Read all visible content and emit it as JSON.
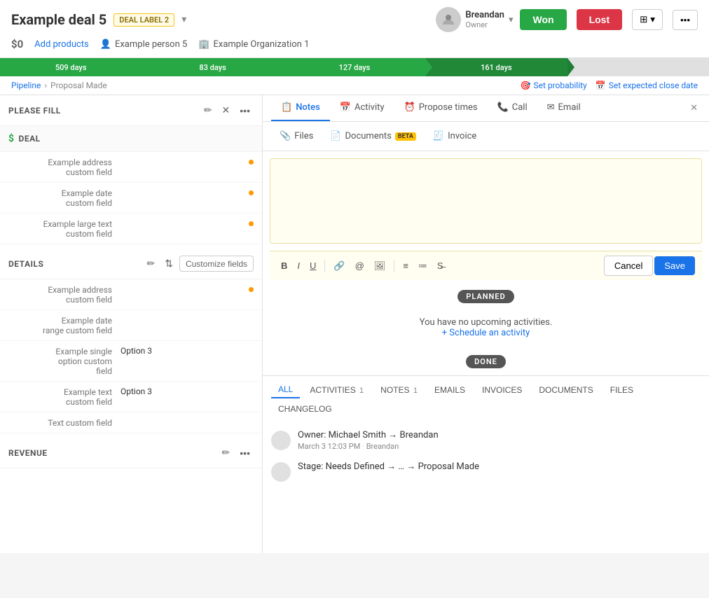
{
  "header": {
    "deal_title": "Example deal 5",
    "deal_label": "DEAL LABEL 2",
    "owner_name": "Breandan",
    "owner_role": "Owner",
    "btn_won": "Won",
    "btn_lost": "Lost",
    "amount": "$0",
    "add_products": "Add products",
    "person": "Example person 5",
    "organization": "Example Organization 1"
  },
  "progress": {
    "segments": [
      {
        "label": "509 days",
        "width": 20,
        "type": "green"
      },
      {
        "label": "83 days",
        "width": 20,
        "type": "green"
      },
      {
        "label": "127 days",
        "width": 20,
        "type": "green"
      },
      {
        "label": "161 days",
        "width": 20,
        "type": "green-dark"
      },
      {
        "label": "",
        "width": 20,
        "type": "gray"
      }
    ]
  },
  "breadcrumb": {
    "pipeline": "Pipeline",
    "stage": "Proposal Made",
    "set_probability": "Set probability",
    "set_close_date": "Set expected close date"
  },
  "please_fill": {
    "title": "PLEASE FILL",
    "section_icon": "✏️"
  },
  "deal_section": {
    "title": "DEAL",
    "fields": [
      {
        "label": "Example address custom field",
        "value": "",
        "required": true
      },
      {
        "label": "Example date custom field",
        "value": "",
        "required": true
      },
      {
        "label": "Example large text custom field",
        "value": "",
        "required": true
      }
    ]
  },
  "details_section": {
    "title": "DETAILS",
    "customize_btn": "Customize fields",
    "fields": [
      {
        "label": "Example address custom field",
        "value": "",
        "required": true
      },
      {
        "label": "Example date range custom field",
        "value": "",
        "required": false
      },
      {
        "label": "Example single option custom field",
        "value": "Option 3",
        "required": false
      },
      {
        "label": "Example text custom field",
        "value": "Option 3",
        "required": false
      },
      {
        "label": "Text custom field",
        "value": "",
        "required": false
      }
    ]
  },
  "revenue_section": {
    "title": "REVENUE"
  },
  "notes_tab": {
    "tabs": [
      {
        "label": "Notes",
        "active": true
      },
      {
        "label": "Activity",
        "active": false
      },
      {
        "label": "Propose times",
        "active": false
      },
      {
        "label": "Call",
        "active": false
      },
      {
        "label": "Email",
        "active": false
      }
    ],
    "sub_tabs": [
      {
        "label": "Files",
        "beta": false
      },
      {
        "label": "Documents",
        "beta": true
      },
      {
        "label": "Invoice",
        "beta": false
      }
    ],
    "editor_placeholder": "",
    "cancel_btn": "Cancel",
    "save_btn": "Save",
    "planned_label": "PLANNED",
    "no_activities_text": "You have no upcoming activities.",
    "schedule_link": "+ Schedule an activity",
    "done_label": "DONE",
    "filter_tabs": [
      {
        "label": "ALL",
        "active": true,
        "count": ""
      },
      {
        "label": "ACTIVITIES",
        "active": false,
        "count": "1"
      },
      {
        "label": "NOTES",
        "active": false,
        "count": "1"
      },
      {
        "label": "EMAILS",
        "active": false,
        "count": ""
      },
      {
        "label": "INVOICES",
        "active": false,
        "count": ""
      },
      {
        "label": "DOCUMENTS",
        "active": false,
        "count": ""
      },
      {
        "label": "FILES",
        "active": false,
        "count": ""
      },
      {
        "label": "CHANGELOG",
        "active": false,
        "count": ""
      }
    ],
    "log_items": [
      {
        "text": "Owner: Michael Smith → Breandan",
        "date": "March 3 12:03 PM",
        "user": "Breandan"
      },
      {
        "text": "Stage: Needs Defined → … → Proposal Made",
        "date": "",
        "user": ""
      }
    ]
  }
}
